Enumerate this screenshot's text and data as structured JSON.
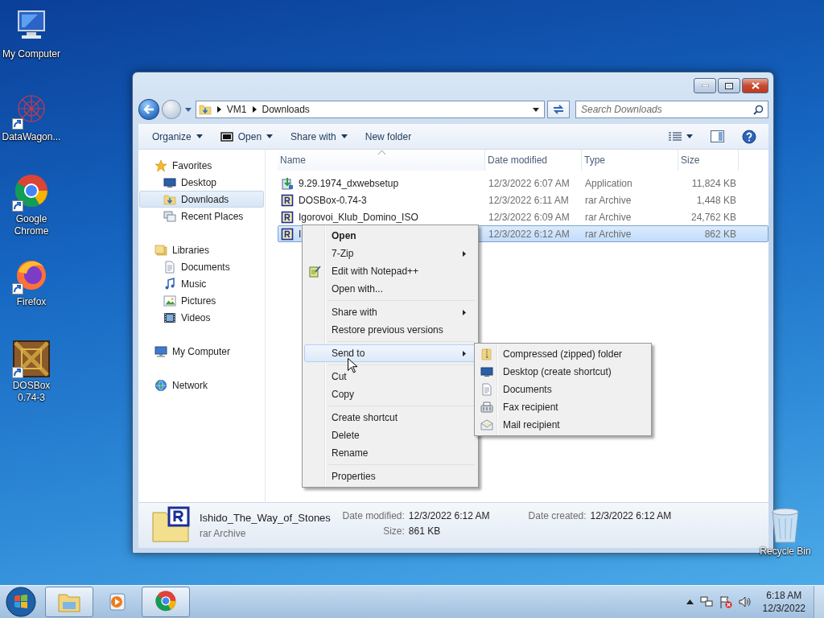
{
  "desktop_icons": [
    {
      "label": "My Computer",
      "kind": "computer",
      "shortcut": false
    },
    {
      "label": "DataWagon...",
      "kind": "datawagon",
      "shortcut": true
    },
    {
      "label": "Google Chrome",
      "kind": "chrome",
      "shortcut": true
    },
    {
      "label": "Firefox",
      "kind": "firefox",
      "shortcut": true
    },
    {
      "label": "DOSBox 0.74-3",
      "kind": "dosbox",
      "shortcut": true
    }
  ],
  "recycle_bin": {
    "label": "Recycle Bin"
  },
  "window": {
    "address": [
      "VM1",
      "Downloads"
    ],
    "search": {
      "placeholder": "Search Downloads"
    },
    "toolbar": [
      {
        "label": "Organize",
        "kind": "plain",
        "dropdown": true
      },
      {
        "label": "Open",
        "kind": "sevenzip",
        "dropdown": true
      },
      {
        "label": "Share with",
        "kind": "plain",
        "dropdown": true
      },
      {
        "label": "New folder",
        "kind": "plain",
        "dropdown": false
      }
    ],
    "nav": [
      {
        "label": "Favorites",
        "kind": "star",
        "children": [
          {
            "label": "Desktop",
            "kind": "desktop",
            "selected": false
          },
          {
            "label": "Downloads",
            "kind": "downloads",
            "selected": true
          },
          {
            "label": "Recent Places",
            "kind": "recent",
            "selected": false
          }
        ]
      },
      {
        "label": "Libraries",
        "kind": "library",
        "children": [
          {
            "label": "Documents",
            "kind": "documents",
            "selected": false
          },
          {
            "label": "Music",
            "kind": "music",
            "selected": false
          },
          {
            "label": "Pictures",
            "kind": "pictures",
            "selected": false
          },
          {
            "label": "Videos",
            "kind": "videos",
            "selected": false
          }
        ]
      },
      {
        "label": "My Computer",
        "kind": "computer"
      },
      {
        "label": "Network",
        "kind": "network"
      }
    ],
    "columns": [
      {
        "label": "Name",
        "sorted": true
      },
      {
        "label": "Date modified",
        "sorted": false
      },
      {
        "label": "Type",
        "sorted": false
      },
      {
        "label": "Size",
        "sorted": false
      }
    ],
    "rows": [
      {
        "kind": "setup",
        "name": "9.29.1974_dxwebsetup",
        "date": "12/3/2022 6:07 AM",
        "type": "Application",
        "size": "11,824 KB",
        "selected": false
      },
      {
        "kind": "rar",
        "name": "DOSBox-0.74-3",
        "date": "12/3/2022 6:11 AM",
        "type": "rar Archive",
        "size": "1,448 KB",
        "selected": false
      },
      {
        "kind": "rar",
        "name": "Igorovoi_Klub_Domino_ISO",
        "date": "12/3/2022 6:09 AM",
        "type": "rar Archive",
        "size": "24,762 KB",
        "selected": false
      },
      {
        "kind": "rar",
        "name": "I",
        "date": "12/3/2022 6:12 AM",
        "type": "rar Archive",
        "size": "862 KB",
        "selected": true
      }
    ],
    "details": {
      "name": "Ishido_The_Way_of_Stones",
      "type": "rar Archive",
      "fields": [
        {
          "label": "Date modified:",
          "value": "12/3/2022 6:12 AM"
        },
        {
          "label": "Size:",
          "value": "861 KB"
        },
        {
          "label": "Date created:",
          "value": "12/3/2022 6:12 AM"
        }
      ]
    }
  },
  "context_menu": {
    "sections": [
      {
        "items": [
          {
            "label": "Open",
            "default": true,
            "submenu": false,
            "kind": "plain",
            "selected": false
          },
          {
            "label": "7-Zip",
            "default": false,
            "submenu": true,
            "kind": "plain",
            "selected": false
          },
          {
            "label": "Edit with Notepad++",
            "default": false,
            "submenu": false,
            "kind": "notepad",
            "selected": false
          },
          {
            "label": "Open with...",
            "default": false,
            "submenu": false,
            "kind": "plain",
            "selected": false
          }
        ]
      },
      {
        "items": [
          {
            "label": "Share with",
            "default": false,
            "submenu": true,
            "kind": "plain",
            "selected": false
          },
          {
            "label": "Restore previous versions",
            "default": false,
            "submenu": false,
            "kind": "plain",
            "selected": false
          }
        ]
      },
      {
        "items": [
          {
            "label": "Send to",
            "default": false,
            "submenu": true,
            "kind": "plain",
            "selected": true
          }
        ]
      },
      {
        "items": [
          {
            "label": "Cut",
            "default": false,
            "submenu": false,
            "kind": "plain",
            "selected": false
          },
          {
            "label": "Copy",
            "default": false,
            "submenu": false,
            "kind": "plain",
            "selected": false
          }
        ]
      },
      {
        "items": [
          {
            "label": "Create shortcut",
            "default": false,
            "submenu": false,
            "kind": "plain",
            "selected": false
          },
          {
            "label": "Delete",
            "default": false,
            "submenu": false,
            "kind": "plain",
            "selected": false
          },
          {
            "label": "Rename",
            "default": false,
            "submenu": false,
            "kind": "plain",
            "selected": false
          }
        ]
      },
      {
        "items": [
          {
            "label": "Properties",
            "default": false,
            "submenu": false,
            "kind": "plain",
            "selected": false
          }
        ]
      }
    ],
    "submenu": [
      {
        "label": "Compressed (zipped) folder",
        "kind": "zip"
      },
      {
        "label": "Desktop (create shortcut)",
        "kind": "desktop"
      },
      {
        "label": "Documents",
        "kind": "documents"
      },
      {
        "label": "Fax recipient",
        "kind": "fax"
      },
      {
        "label": "Mail recipient",
        "kind": "mail"
      }
    ]
  },
  "taskbar": {
    "buttons": [
      {
        "kind": "explorer",
        "selected": true
      },
      {
        "kind": "media",
        "selected": false
      },
      {
        "kind": "chrome",
        "selected": true
      }
    ],
    "clock": {
      "time": "6:18 AM",
      "date": "12/3/2022"
    }
  }
}
